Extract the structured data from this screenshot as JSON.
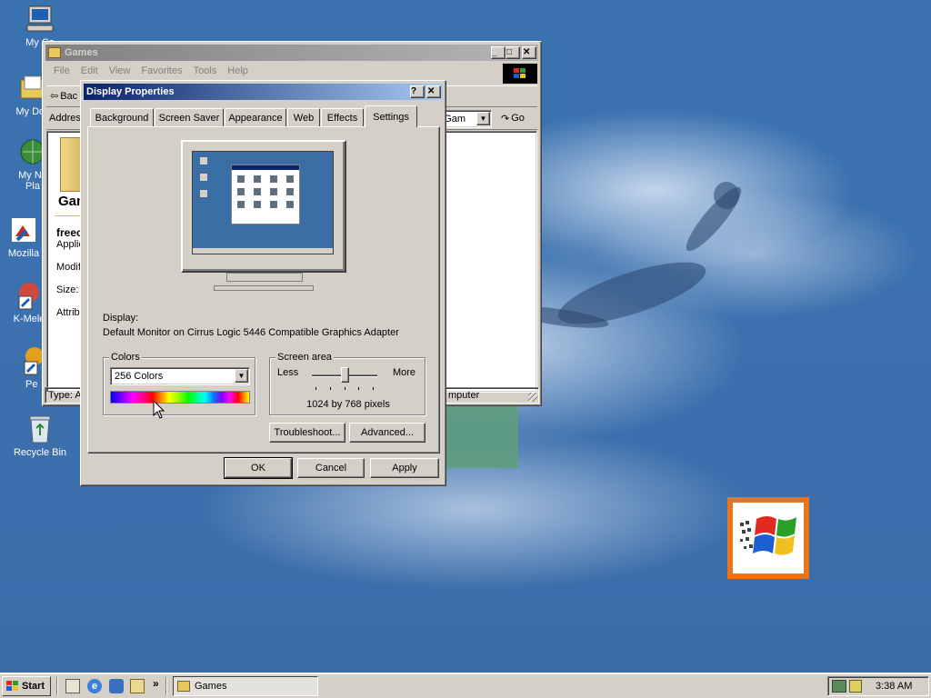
{
  "desktop": {
    "icons": [
      {
        "label": "My Co"
      },
      {
        "label": "My Doc"
      },
      {
        "label": "My Ne"
      },
      {
        "label": "Pla"
      },
      {
        "label": "Mozilla"
      },
      {
        "label": "K-Mele"
      },
      {
        "label": "Pe"
      },
      {
        "label": "Recycle Bin"
      }
    ]
  },
  "explorer": {
    "title": "Games",
    "menu": [
      "File",
      "Edit",
      "View",
      "Favorites",
      "Tools",
      "Help"
    ],
    "back_label": "Bac",
    "address_label": "Addres",
    "address_value": "ta Gam",
    "go_label": "Go",
    "folder_title": "Gan",
    "item_name": "freec",
    "item_type": "Applic",
    "modified_label": "Modif",
    "size_label": "Size:",
    "attributes_label": "Attrib",
    "status_left": "Type: A",
    "status_right": "mputer"
  },
  "dialog": {
    "title": "Display Properties",
    "help_btn": "?",
    "close_btn": "✕",
    "tabs": [
      "Background",
      "Screen Saver",
      "Appearance",
      "Web",
      "Effects",
      "Settings"
    ],
    "selected_tab": "Settings",
    "display_label": "Display:",
    "display_value": "Default Monitor on Cirrus Logic 5446 Compatible Graphics Adapter",
    "colors_group": "Colors",
    "colors_value": "256 Colors",
    "screen_area_group": "Screen area",
    "less_label": "Less",
    "more_label": "More",
    "slider_fraction": 0.5,
    "resolution_text": "1024 by 768 pixels",
    "troubleshoot_btn": "Troubleshoot...",
    "advanced_btn": "Advanced...",
    "ok_btn": "OK",
    "cancel_btn": "Cancel",
    "apply_btn": "Apply"
  },
  "taskbar": {
    "start_label": "Start",
    "task_games": "Games",
    "clock": "3:38 AM",
    "quicklaunch_more": "»"
  },
  "colors": {
    "title_active": "#0a246a",
    "title_inactive": "#808080",
    "face": "#d4d0c8",
    "desktop": "#3a6ea5"
  }
}
